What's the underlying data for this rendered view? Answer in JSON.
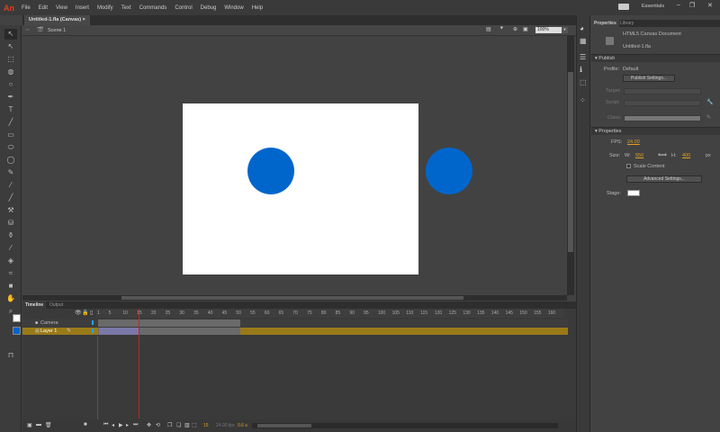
{
  "app": {
    "logo": "An",
    "menus": [
      "File",
      "Edit",
      "View",
      "Insert",
      "Modify",
      "Text",
      "Commands",
      "Control",
      "Debug",
      "Window",
      "Help"
    ],
    "workspace": "Essentials"
  },
  "document": {
    "tab_title": "Untitled-1.fla (Canvas)",
    "scene": "Scene 1",
    "zoom": "100%"
  },
  "stage": {
    "background": "#ffffff",
    "circle_color": "#0066cc"
  },
  "timeline": {
    "tabs": [
      "Timeline",
      "Output"
    ],
    "frame_labels": [
      "1",
      "5",
      "10",
      "15",
      "20",
      "25",
      "30",
      "35",
      "40",
      "45",
      "50",
      "55",
      "60",
      "65",
      "70",
      "75",
      "80",
      "85",
      "90",
      "95",
      "100",
      "105",
      "110",
      "115",
      "120",
      "125",
      "130",
      "135",
      "140",
      "145",
      "150",
      "155",
      "160"
    ],
    "current_frame": "15",
    "fps": "24.00 fps",
    "time": "0.6 s",
    "playhead_frame": 15,
    "layers": [
      {
        "name": "Camera"
      },
      {
        "name": "Layer 1"
      }
    ]
  },
  "properties": {
    "tabs": [
      "Properties",
      "Library"
    ],
    "doc_type": "HTML5 Canvas Document",
    "doc_name": "Untitled-1.fla",
    "publish": {
      "header": "Publish",
      "profile_label": "Profile:",
      "profile_value": "Default",
      "settings_button": "Publish Settings...",
      "target_label": "Target:",
      "script_label": "Script:",
      "class_label": "Class:"
    },
    "props": {
      "header": "Properties",
      "fps_label": "FPS:",
      "fps_value": "24.00",
      "size_label": "Size:",
      "w_label": "W:",
      "w_value": "550",
      "h_label": "H:",
      "h_value": "400",
      "unit": "px",
      "scale_content": "Scale Content",
      "advanced_button": "Advanced Settings...",
      "stage_label": "Stage:",
      "stage_color": "#ffffff"
    }
  }
}
